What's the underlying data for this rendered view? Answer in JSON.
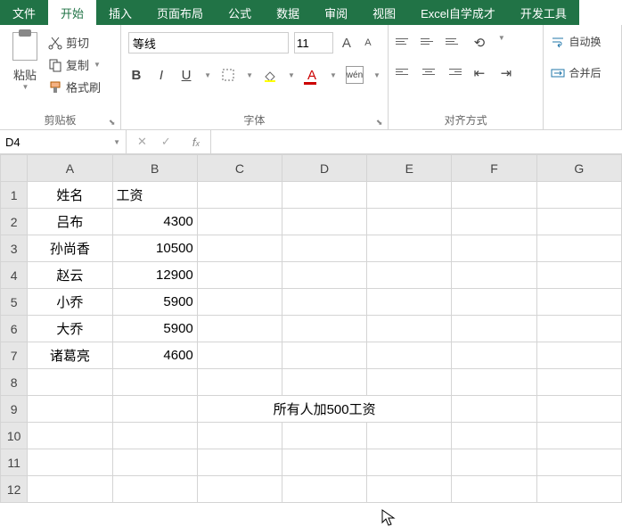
{
  "tabs": {
    "file": "文件",
    "home": "开始",
    "insert": "插入",
    "layout": "页面布局",
    "formula": "公式",
    "data": "数据",
    "review": "审阅",
    "view": "视图",
    "custom1": "Excel自学成才",
    "devtools": "开发工具"
  },
  "ribbon": {
    "clipboard": {
      "paste": "粘贴",
      "cut": "剪切",
      "copy": "复制",
      "format_painter": "格式刷",
      "label": "剪贴板"
    },
    "font": {
      "name": "等线",
      "size": "11",
      "label": "字体"
    },
    "align": {
      "label": "对齐方式",
      "wrap": "自动换",
      "merge": "合并后"
    }
  },
  "namebox": "D4",
  "formula": "",
  "columns": [
    "A",
    "B",
    "C",
    "D",
    "E",
    "F",
    "G"
  ],
  "chart_data": {
    "type": "table",
    "headers": [
      "姓名",
      "工资"
    ],
    "rows": [
      [
        "吕布",
        4300
      ],
      [
        "孙尚香",
        10500
      ],
      [
        "赵云",
        12900
      ],
      [
        "小乔",
        5900
      ],
      [
        "大乔",
        5900
      ],
      [
        "诸葛亮",
        4600
      ]
    ],
    "note": "所有人加500工资"
  }
}
